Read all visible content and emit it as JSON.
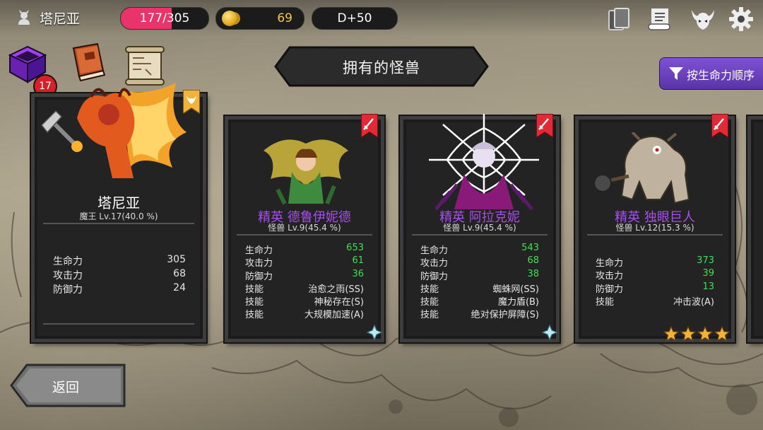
{
  "header": {
    "player_name": "塔尼亚",
    "hp_current": "177",
    "hp_max": "305",
    "hp_fraction": 0.58,
    "gold": "69",
    "day": "D+50"
  },
  "badge_count": "17",
  "title": "拥有的怪兽",
  "sort_label": "按生命力顺序",
  "back_label": "返回",
  "colors": {
    "hp": "#e8336b",
    "gold": "#f3c54d",
    "elite": "#a84df0",
    "stat_value_green": "#3ee052",
    "sort_bg": "#6a42c0"
  },
  "cards": [
    {
      "name": "塔尼亚",
      "level": "魔王 Lv.17(40.0 %)",
      "stats": [
        {
          "label": "生命力",
          "value": "305"
        },
        {
          "label": "攻击力",
          "value": "68"
        },
        {
          "label": "防御力",
          "value": "24"
        }
      ],
      "skills": []
    },
    {
      "name": "精英 德鲁伊妮德",
      "level": "怪兽 Lv.9(45.4 %)",
      "stats": [
        {
          "label": "生命力",
          "value": "653"
        },
        {
          "label": "攻击力",
          "value": "61"
        },
        {
          "label": "防御力",
          "value": "36"
        }
      ],
      "skills": [
        {
          "label": "技能",
          "value": "治愈之雨(SS)"
        },
        {
          "label": "技能",
          "value": "神秘存在(S)"
        },
        {
          "label": "技能",
          "value": "大规模加速(A)"
        }
      ]
    },
    {
      "name": "精英 阿拉克妮",
      "level": "怪兽 Lv.9(45.4 %)",
      "stats": [
        {
          "label": "生命力",
          "value": "543"
        },
        {
          "label": "攻击力",
          "value": "68"
        },
        {
          "label": "防御力",
          "value": "38"
        }
      ],
      "skills": [
        {
          "label": "技能",
          "value": "蜘蛛网(SS)"
        },
        {
          "label": "技能",
          "value": "魔力盾(B)"
        },
        {
          "label": "技能",
          "value": "绝对保护屏障(S)"
        }
      ]
    },
    {
      "name": "精英 独眼巨人",
      "level": "怪兽 Lv.12(15.3 %)",
      "stars": 4,
      "stats": [
        {
          "label": "生命力",
          "value": "373"
        },
        {
          "label": "攻击力",
          "value": "39"
        },
        {
          "label": "防御力",
          "value": "13"
        }
      ],
      "skills": [
        {
          "label": "技能",
          "value": "冲击波(A)"
        }
      ]
    }
  ]
}
